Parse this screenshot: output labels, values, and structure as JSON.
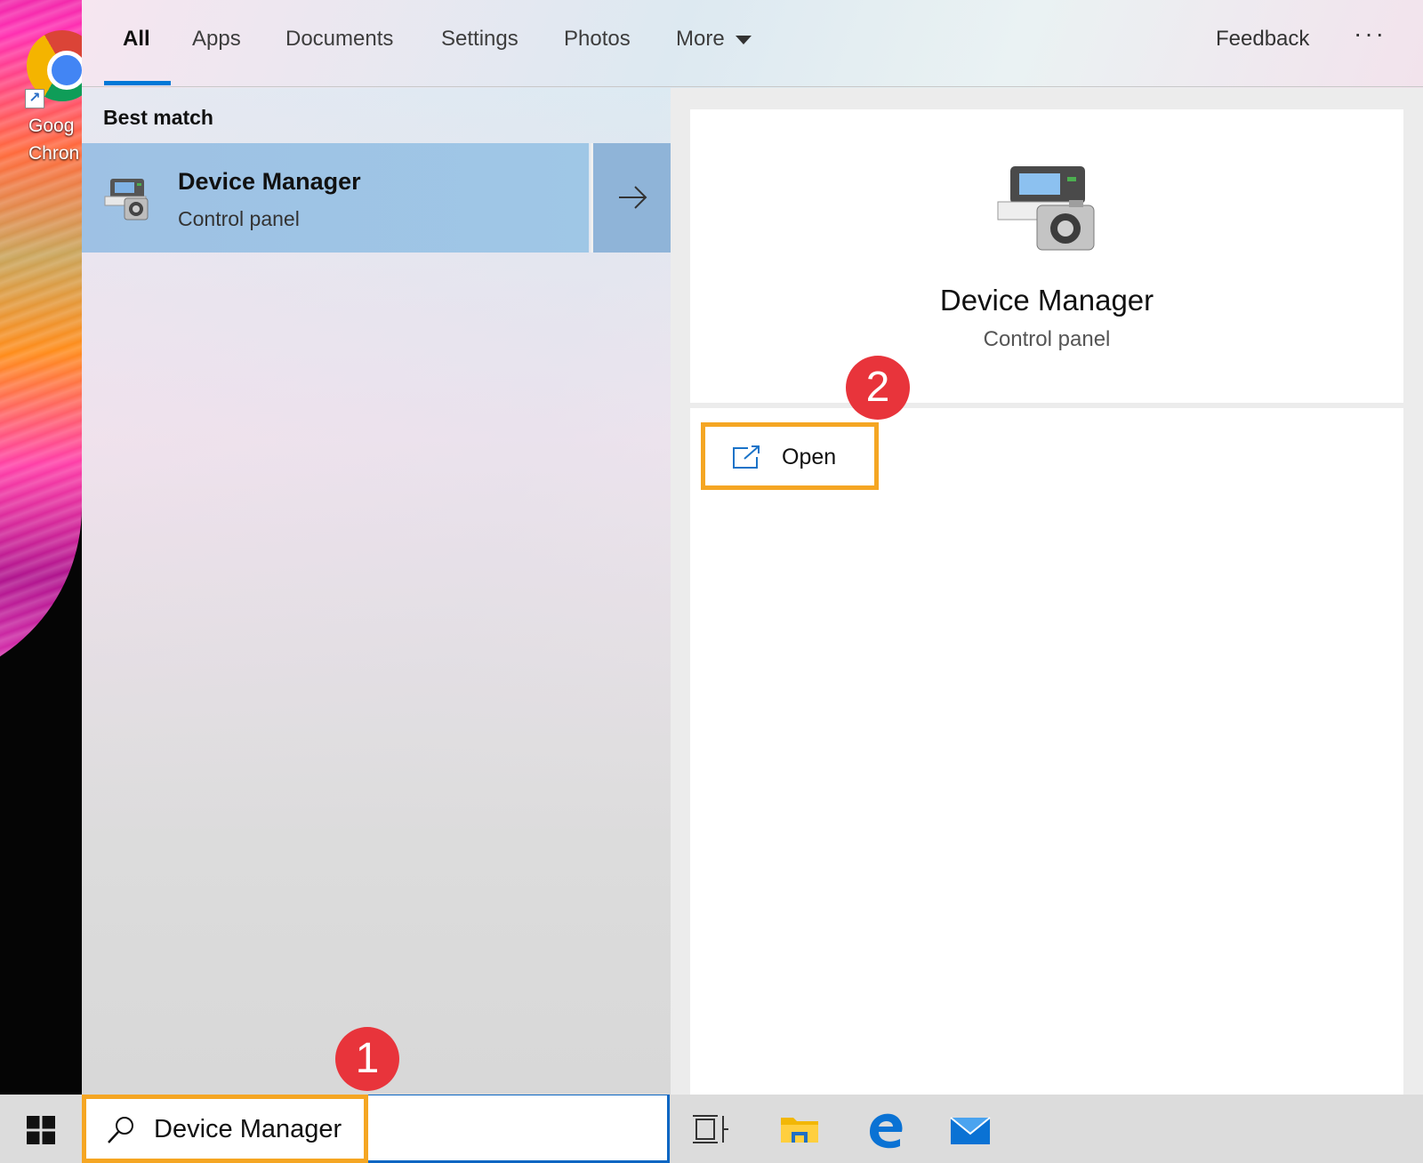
{
  "desktop": {
    "shortcut_label": "Goog\nChron",
    "shortcut_label_line1": "Goog",
    "shortcut_label_line2": "Chron"
  },
  "tabs": [
    {
      "label": "All",
      "active": true
    },
    {
      "label": "Apps"
    },
    {
      "label": "Documents"
    },
    {
      "label": "Settings"
    },
    {
      "label": "Photos"
    },
    {
      "label": "More"
    }
  ],
  "header": {
    "feedback_label": "Feedback",
    "more_options": "···"
  },
  "results": {
    "section_heading": "Best match",
    "best_match": {
      "title": "Device Manager",
      "subtitle": "Control panel",
      "icon": "device-manager-icon"
    }
  },
  "detail": {
    "title": "Device Manager",
    "subtitle": "Control panel",
    "open_label": "Open"
  },
  "search": {
    "query": "Device Manager"
  },
  "annotations": {
    "step1": "1",
    "step2": "2"
  },
  "colors": {
    "accent": "#0078d7",
    "highlight": "#f5a623",
    "badge": "#e8343b",
    "selected_result": "#9ec1e4"
  }
}
